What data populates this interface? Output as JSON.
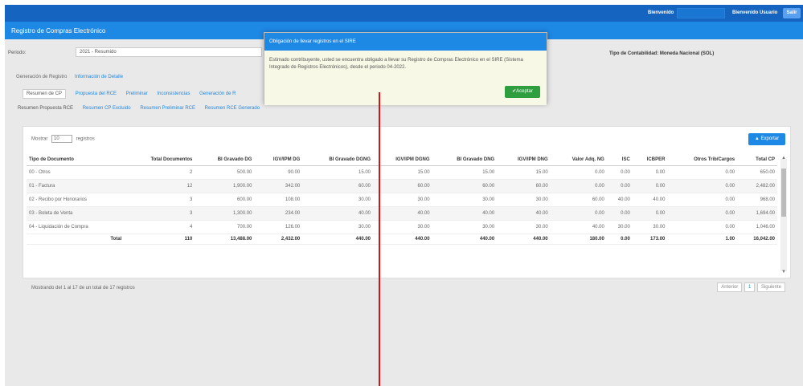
{
  "topbar": {
    "user_label": "Bienvenido",
    "user_select_value": "",
    "name": "Bienvenido Usuario",
    "exit_label": "Salir"
  },
  "app": {
    "title": "Registro de Compras Electrónico"
  },
  "filters": {
    "periodo_label": "Periodo:",
    "periodo_value": "2021 - Resumido",
    "tipo_contabilidad": "Tipo de Contabilidad: Moneda Nacional (SOL)"
  },
  "subtabs": [
    "Generación de Registro",
    "Información de Detalle"
  ],
  "tabs1": [
    "Resumen de CP",
    "Propuesta del RCE",
    "Preliminar",
    "Inconsistencias",
    "Generación de R"
  ],
  "tabs2": [
    "Resumen Propuesta RCE",
    "Resumen CP Excluido",
    "Resumen Preliminar RCE",
    "Resumen RCE Generado"
  ],
  "table": {
    "show_label": "Mostrar",
    "page_size": "10",
    "records_label": "registros",
    "export_label": "Exportar",
    "headers": [
      "Tipo de Documento",
      "Total Documentos",
      "BI Gravado DG",
      "IGV/IPM DG",
      "BI Gravado DGNG",
      "IGV/IPM DGNG",
      "BI Gravado DNG",
      "IGV/IPM DNG",
      "Valor Adq. NG",
      "ISC",
      "ICBPER",
      "Otros Trib/Cargos",
      "Total CP"
    ],
    "rows": [
      [
        "00 - Otros",
        "2",
        "500.00",
        "90.00",
        "15.00",
        "15.00",
        "15.00",
        "15.00",
        "0.00",
        "0.00",
        "0.00",
        "0.00",
        "650.00"
      ],
      [
        "01 - Factura",
        "12",
        "1,900.00",
        "342.00",
        "60.00",
        "60.00",
        "60.00",
        "60.00",
        "0.00",
        "0.00",
        "0.00",
        "0.00",
        "2,482.00"
      ],
      [
        "02 - Recibo por Honorarios",
        "3",
        "600.00",
        "108.00",
        "30.00",
        "30.00",
        "30.00",
        "30.00",
        "60.00",
        "40.00",
        "40.00",
        "0.00",
        "968.00"
      ],
      [
        "03 - Boleta de Venta",
        "3",
        "1,300.00",
        "234.00",
        "40.00",
        "40.00",
        "40.00",
        "40.00",
        "0.00",
        "0.00",
        "0.00",
        "0.00",
        "1,694.00"
      ],
      [
        "04 - Liquidación de Compra",
        "4",
        "700.00",
        "126.00",
        "30.00",
        "30.00",
        "30.00",
        "30.00",
        "40.00",
        "30.00",
        "30.00",
        "0.00",
        "1,046.00"
      ]
    ],
    "total_label": "Total",
    "totals": [
      "110",
      "13,488.00",
      "2,432.00",
      "440.00",
      "440.00",
      "440.00",
      "440.00",
      "180.00",
      "0.00",
      "173.00",
      "1.00",
      "16,042.00"
    ],
    "footer_info": "Mostrando del 1 al 17 de un total de 17 registros",
    "pager": [
      "Anterior",
      "1",
      "Siguiente"
    ]
  },
  "modal": {
    "title": "Obligación de llevar registros en el SIRE",
    "body": "Estimado contribuyente, usted se encuentra obligado a llevar su Registro de Compras Electrónico en el SIRE (Sistema Integrado de Registros Electrónicos), desde el periodo 04-2022.",
    "accept_label": "✔Aceptar"
  }
}
